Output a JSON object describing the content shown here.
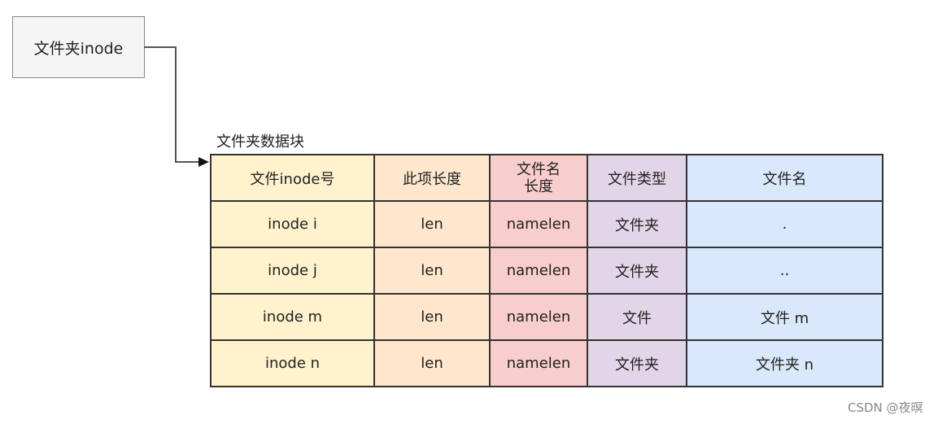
{
  "inode_box": {
    "label": "文件夹inode"
  },
  "table_caption": "文件夹数据块",
  "table": {
    "headers": [
      "文件inode号",
      "此项长度",
      "文件名\n长度",
      "文件类型",
      "文件名"
    ],
    "header_lines": {
      "name_len_1": "文件名",
      "name_len_2": "长度"
    },
    "rows": [
      [
        "inode i",
        "len",
        "namelen",
        "文件夹",
        "."
      ],
      [
        "inode j",
        "len",
        "namelen",
        "文件夹",
        ".."
      ],
      [
        "inode m",
        "len",
        "namelen",
        "文件",
        "文件 m"
      ],
      [
        "inode n",
        "len",
        "namelen",
        "文件夹",
        "文件夹 n"
      ]
    ]
  },
  "colors": {
    "inode_col": "#fff2cc",
    "len_col": "#ffe6cc",
    "namelen_col": "#f8cecc",
    "type_col": "#e1d5e7",
    "name_col": "#dae8fc"
  },
  "watermark": "CSDN @夜暝"
}
